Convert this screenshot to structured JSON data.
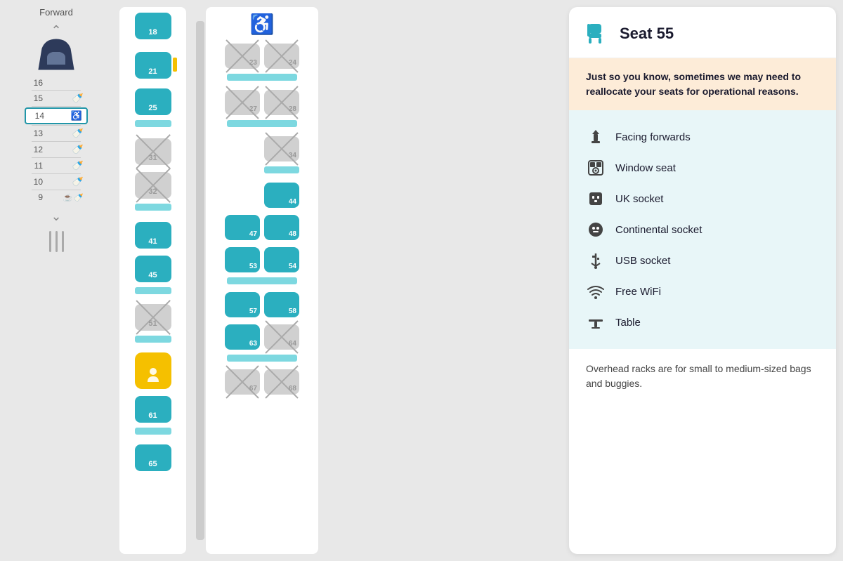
{
  "trainMap": {
    "label": "Forward",
    "rows": [
      {
        "num": "16",
        "icons": []
      },
      {
        "num": "15",
        "icons": [
          "baby"
        ]
      },
      {
        "num": "14",
        "icons": [
          "wheelchair"
        ],
        "highlighted": true
      },
      {
        "num": "13",
        "icons": [
          "baby"
        ]
      },
      {
        "num": "12",
        "icons": [
          "baby"
        ]
      },
      {
        "num": "11",
        "icons": [
          "baby"
        ]
      },
      {
        "num": "10",
        "icons": [
          "baby"
        ]
      },
      {
        "num": "9",
        "icons": [
          "cup",
          "baby"
        ]
      }
    ]
  },
  "carriages": {
    "carriage1": {
      "seats": [
        {
          "id": "18",
          "status": "available"
        },
        {
          "id": "21",
          "status": "available"
        },
        {
          "id": "25",
          "status": "available"
        },
        {
          "id": "31",
          "status": "unavailable"
        },
        {
          "id": "32",
          "status": "unavailable"
        },
        {
          "id": "41",
          "status": "available"
        },
        {
          "id": "45",
          "status": "available"
        },
        {
          "id": "51",
          "status": "unavailable"
        },
        {
          "id": "55",
          "status": "selected"
        },
        {
          "id": "61",
          "status": "available"
        },
        {
          "id": "65",
          "status": "available"
        }
      ]
    },
    "carriage2": {
      "seats": [
        {
          "id": "23",
          "status": "unavailable"
        },
        {
          "id": "24",
          "status": "unavailable"
        },
        {
          "id": "27",
          "status": "unavailable"
        },
        {
          "id": "28",
          "status": "unavailable"
        },
        {
          "id": "34",
          "status": "unavailable"
        },
        {
          "id": "44",
          "status": "available"
        },
        {
          "id": "47",
          "status": "available"
        },
        {
          "id": "48",
          "status": "available"
        },
        {
          "id": "53",
          "status": "available"
        },
        {
          "id": "54",
          "status": "available"
        },
        {
          "id": "57",
          "status": "available"
        },
        {
          "id": "58",
          "status": "available"
        },
        {
          "id": "63",
          "status": "available"
        },
        {
          "id": "64",
          "status": "unavailable"
        },
        {
          "id": "67",
          "status": "unavailable"
        },
        {
          "id": "68",
          "status": "unavailable"
        }
      ]
    }
  },
  "seatInfo": {
    "title": "Seat 55",
    "iconLabel": "seat-icon",
    "warning": "Just so you know, sometimes we may need to reallocate your seats for operational reasons.",
    "features": [
      {
        "icon": "↑",
        "label": "Facing forwards",
        "iconName": "facing-forwards-icon"
      },
      {
        "icon": "👤",
        "label": "Window seat",
        "iconName": "window-seat-icon"
      },
      {
        "icon": "🔌",
        "label": "UK socket",
        "iconName": "uk-socket-icon"
      },
      {
        "icon": "⚫",
        "label": "Continental socket",
        "iconName": "continental-socket-icon"
      },
      {
        "icon": "⚡",
        "label": "USB socket",
        "iconName": "usb-socket-icon"
      },
      {
        "icon": "📶",
        "label": "Free WiFi",
        "iconName": "wifi-icon"
      },
      {
        "icon": "⬜",
        "label": "Table",
        "iconName": "table-icon"
      }
    ],
    "overheadNote": "Overhead racks are for small to medium-sized bags and buggies."
  }
}
